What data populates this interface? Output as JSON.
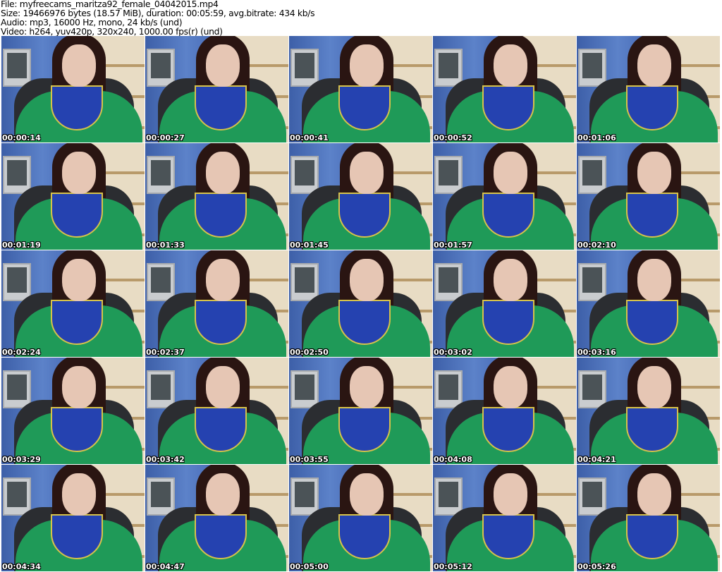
{
  "header": {
    "file": "File: myfreecams_maritza92_female_04042015.mp4",
    "size": "Size: 19466976 bytes (18.57 MiB), duration: 00:05:59, avg.bitrate: 434 kb/s",
    "audio": "Audio: mp3, 16000 Hz, mono, 24 kb/s (und)",
    "video": "Video: h264, yuv420p, 320x240, 1000.00 fps(r) (und)"
  },
  "thumbnails": [
    "00:00:14",
    "00:00:27",
    "00:00:41",
    "00:00:52",
    "00:01:06",
    "00:01:19",
    "00:01:33",
    "00:01:45",
    "00:01:57",
    "00:02:10",
    "00:02:24",
    "00:02:37",
    "00:02:50",
    "00:03:02",
    "00:03:16",
    "00:03:29",
    "00:03:42",
    "00:03:55",
    "00:04:08",
    "00:04:21",
    "00:04:34",
    "00:04:47",
    "00:05:00",
    "00:05:12",
    "00:05:26"
  ]
}
